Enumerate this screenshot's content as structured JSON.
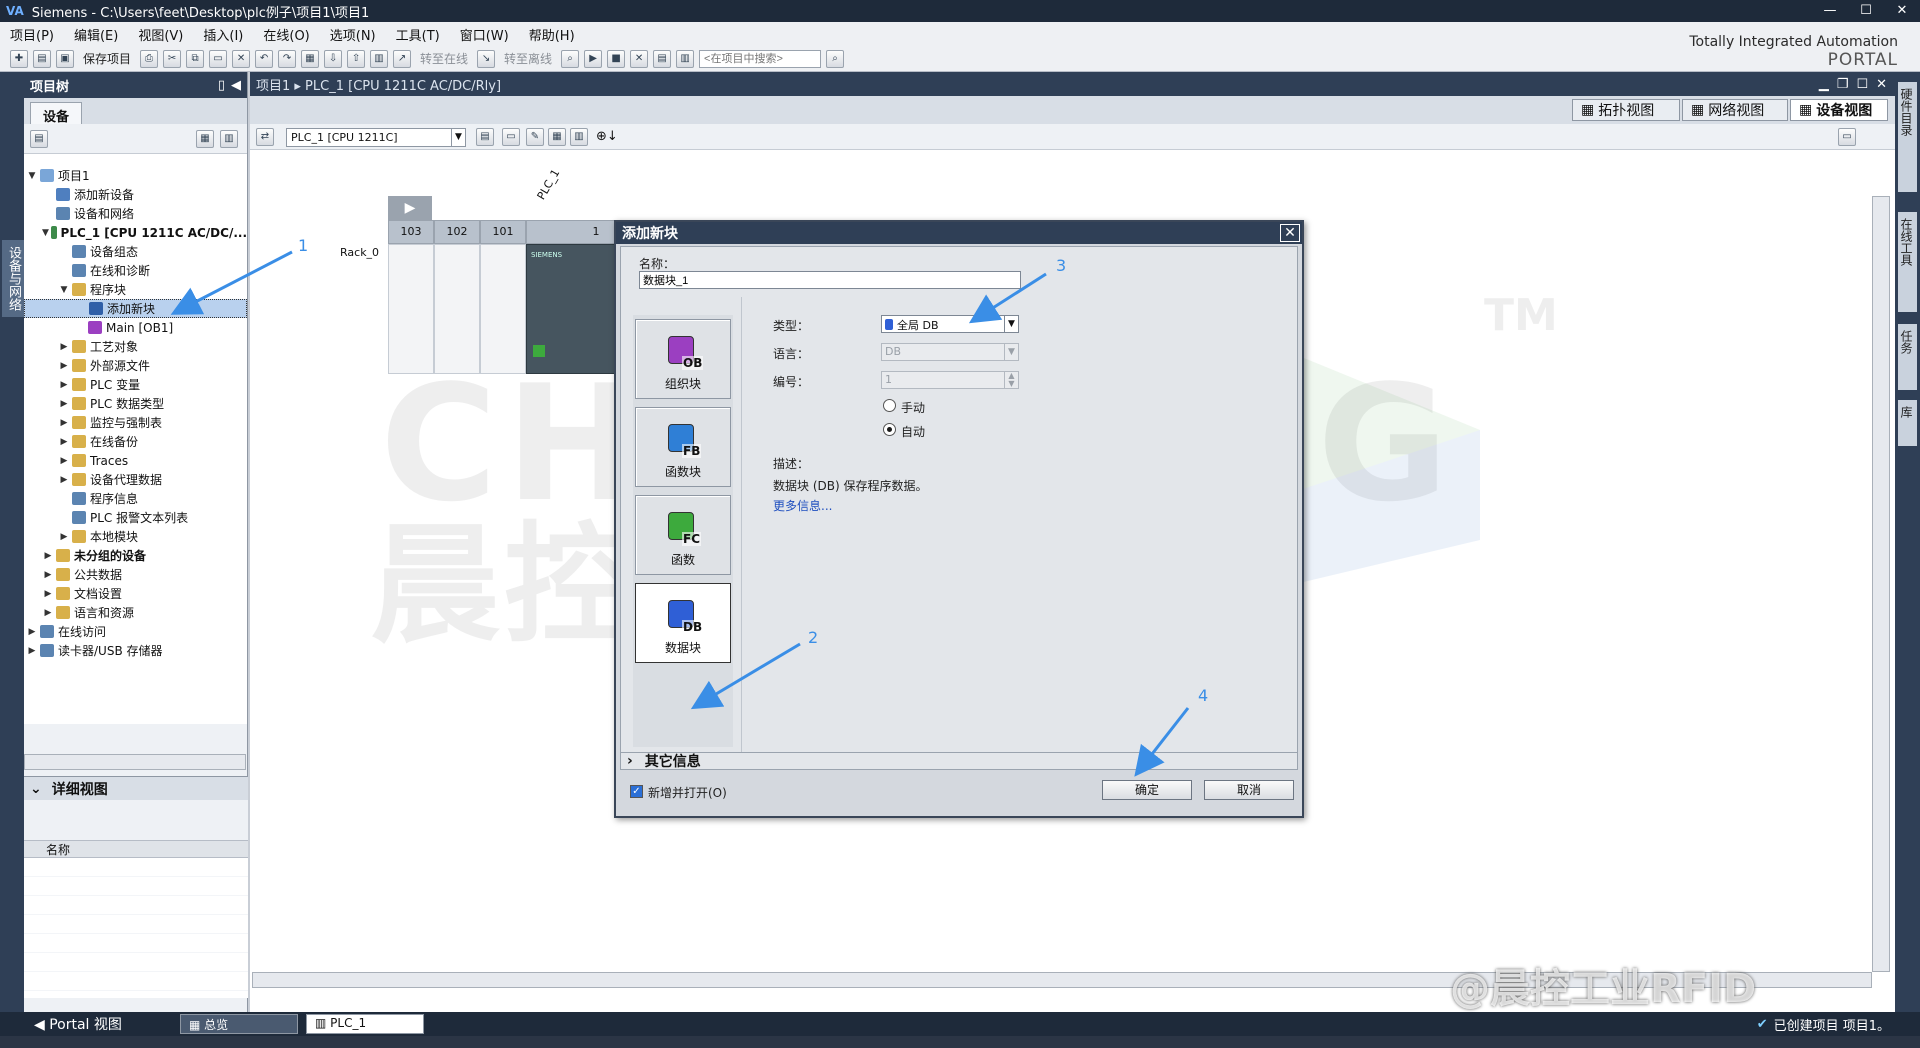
{
  "app": {
    "title": "Siemens  -  C:\\Users\\feet\\Desktop\\plc例子\\项目1\\项目1",
    "logo": "VA",
    "brand_line1": "Totally Integrated Automation",
    "brand_line2": "PORTAL"
  },
  "menu": [
    "项目(P)",
    "编辑(E)",
    "视图(V)",
    "插入(I)",
    "在线(O)",
    "选项(N)",
    "工具(T)",
    "窗口(W)",
    "帮助(H)"
  ],
  "toolbar": {
    "save_label": "保存项目",
    "go_online": "转至在线",
    "go_offline": "转至离线",
    "search_placeholder": "<在项目中搜索>"
  },
  "left_vtab": "设备与网络",
  "project_tree": {
    "title": "项目树",
    "tab": "设备",
    "items": [
      {
        "label": "项目1",
        "indent": 0,
        "exp": "▼",
        "icon": "project-icon",
        "color": "#7aa6d8"
      },
      {
        "label": "添加新设备",
        "indent": 1,
        "exp": "",
        "icon": "add-device-icon",
        "color": "#4f7fbf"
      },
      {
        "label": "设备和网络",
        "indent": 1,
        "exp": "",
        "icon": "network-icon",
        "color": "#5b84b1"
      },
      {
        "label": "PLC_1 [CPU 1211C AC/DC/...",
        "indent": 1,
        "exp": "▼",
        "icon": "plc-icon",
        "color": "#3d8a4a",
        "bold": true
      },
      {
        "label": "设备组态",
        "indent": 2,
        "exp": "",
        "icon": "device-config-icon",
        "color": "#5b84b1"
      },
      {
        "label": "在线和诊断",
        "indent": 2,
        "exp": "",
        "icon": "diagnostics-icon",
        "color": "#5b84b1"
      },
      {
        "label": "程序块",
        "indent": 2,
        "exp": "▼",
        "icon": "folder-icon",
        "color": "#d8b04a"
      },
      {
        "label": "添加新块",
        "indent": 3,
        "exp": "",
        "icon": "add-block-icon",
        "color": "#2f5fa8",
        "selected": true
      },
      {
        "label": "Main [OB1]",
        "indent": 3,
        "exp": "",
        "icon": "ob-icon",
        "color": "#9b3fc1"
      },
      {
        "label": "工艺对象",
        "indent": 2,
        "exp": "▶",
        "icon": "folder-icon",
        "color": "#d8b04a"
      },
      {
        "label": "外部源文件",
        "indent": 2,
        "exp": "▶",
        "icon": "folder-icon",
        "color": "#d8b04a"
      },
      {
        "label": "PLC 变量",
        "indent": 2,
        "exp": "▶",
        "icon": "tag-icon",
        "color": "#d8b04a"
      },
      {
        "label": "PLC 数据类型",
        "indent": 2,
        "exp": "▶",
        "icon": "datatype-icon",
        "color": "#d8b04a"
      },
      {
        "label": "监控与强制表",
        "indent": 2,
        "exp": "▶",
        "icon": "watch-icon",
        "color": "#d8b04a"
      },
      {
        "label": "在线备份",
        "indent": 2,
        "exp": "▶",
        "icon": "backup-icon",
        "color": "#d8b04a"
      },
      {
        "label": "Traces",
        "indent": 2,
        "exp": "▶",
        "icon": "trace-icon",
        "color": "#d8b04a"
      },
      {
        "label": "设备代理数据",
        "indent": 2,
        "exp": "▶",
        "icon": "proxy-icon",
        "color": "#d8b04a"
      },
      {
        "label": "程序信息",
        "indent": 2,
        "exp": "",
        "icon": "info-icon",
        "color": "#5b84b1"
      },
      {
        "label": "PLC 报警文本列表",
        "indent": 2,
        "exp": "",
        "icon": "alarm-text-icon",
        "color": "#5b84b1"
      },
      {
        "label": "本地模块",
        "indent": 2,
        "exp": "▶",
        "icon": "folder-icon",
        "color": "#d8b04a"
      },
      {
        "label": "未分组的设备",
        "indent": 1,
        "exp": "▶",
        "icon": "folder-icon",
        "color": "#d8b04a",
        "bold": true
      },
      {
        "label": "公共数据",
        "indent": 1,
        "exp": "▶",
        "icon": "folder-icon",
        "color": "#d8b04a"
      },
      {
        "label": "文档设置",
        "indent": 1,
        "exp": "▶",
        "icon": "doc-icon",
        "color": "#d8b04a"
      },
      {
        "label": "语言和资源",
        "indent": 1,
        "exp": "▶",
        "icon": "language-icon",
        "color": "#d8b04a"
      },
      {
        "label": "在线访问",
        "indent": 0,
        "exp": "▶",
        "icon": "online-icon",
        "color": "#5b84b1"
      },
      {
        "label": "读卡器/USB 存储器",
        "indent": 0,
        "exp": "▶",
        "icon": "usb-icon",
        "color": "#5b84b1"
      }
    ]
  },
  "detail_view": {
    "title": "详细视图",
    "col_name": "名称"
  },
  "workspace": {
    "breadcrumb": "项目1  ▸  PLC_1 [CPU 1211C AC/DC/Rly]",
    "tabs": [
      "拓扑视图",
      "网络视图",
      "设备视图"
    ],
    "device_select": "PLC_1 [CPU 1211C]",
    "plc_label": "PLC_1",
    "rack_label": "Rack_0",
    "slots": [
      "103",
      "102",
      "101",
      "1"
    ],
    "cpu_brand": "SIEMENS"
  },
  "right_vtabs": [
    "硬件目录",
    "在线工具",
    "任务",
    "库"
  ],
  "watermark": {
    "line1": "CHENKONG",
    "line2": "晨控智能",
    "tm": "TM",
    "corner": "@晨控工业RFID"
  },
  "dialog": {
    "title": "添加新块",
    "name_label": "名称：",
    "name_value": "数据块_1",
    "blocks": [
      {
        "label": "组织块",
        "tag": "OB",
        "color": "#9b3fc1"
      },
      {
        "label": "函数块",
        "tag": "FB",
        "color": "#2f7fd6"
      },
      {
        "label": "函数",
        "tag": "FC",
        "color": "#3daa3d"
      },
      {
        "label": "数据块",
        "tag": "DB",
        "color": "#2f5fd6"
      }
    ],
    "type_label": "类型：",
    "type_value": "全局 DB",
    "lang_label": "语言：",
    "lang_value": "DB",
    "num_label": "编号：",
    "num_value": "1",
    "manual_label": "手动",
    "auto_label": "自动",
    "desc_label": "描述：",
    "desc_text": "数据块 (DB) 保存程序数据。",
    "more_info": "更多信息...",
    "other_info": "其它信息",
    "open_label": "新增并打开(O)",
    "ok": "确定",
    "cancel": "取消"
  },
  "annotations": [
    "1",
    "2",
    "3",
    "4"
  ],
  "statusbar": {
    "portal": "Portal 视图",
    "tab_overview": "总览",
    "tab_plc": "PLC_1",
    "message": "已创建项目 项目1。"
  }
}
